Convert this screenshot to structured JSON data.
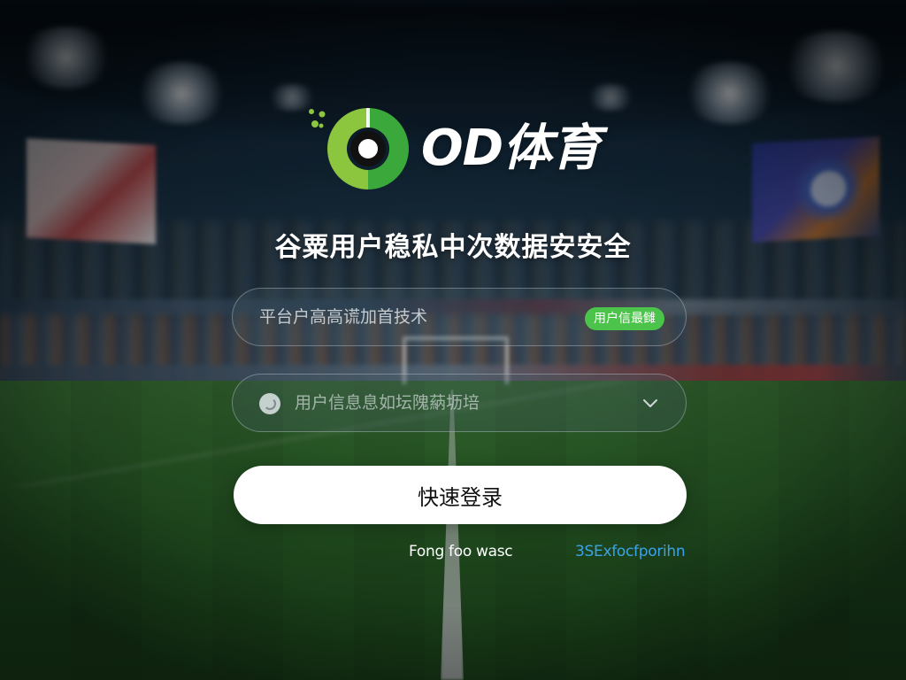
{
  "logo": {
    "text": "OD体育",
    "icon": "od-sports-logo-icon",
    "colors": {
      "green_light": "#8cc63f",
      "green_dark": "#3aa83a",
      "white": "#ffffff"
    }
  },
  "tagline": "谷粟用户稳私中次数据安安全",
  "form": {
    "field1": {
      "value": "平台户高高谎加首技术",
      "badge": "用户信最雠"
    },
    "field2": {
      "value": "用户信息息如坛隗蒳坜培",
      "icon": "user-circle-icon",
      "trailing_icon": "chevron-down-icon"
    },
    "login_button": "快速登录",
    "link_left": "Fong foo wasc",
    "link_right": "3SExfocfporihn"
  },
  "colors": {
    "accent_green": "#4cc34a",
    "link_blue": "#3aa3e8",
    "button_bg": "#ffffff"
  }
}
